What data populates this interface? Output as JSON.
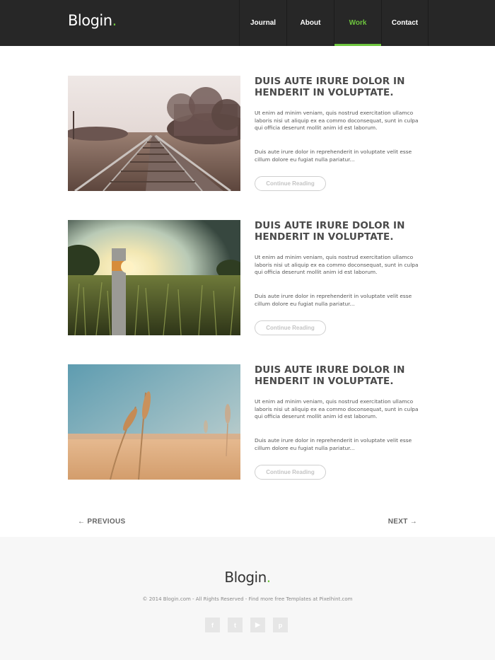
{
  "header": {
    "logo_text": "Blogin",
    "logo_dot": ".",
    "nav": [
      {
        "label": "Journal"
      },
      {
        "label": "About"
      },
      {
        "label": "Work",
        "active": true
      },
      {
        "label": "Contact"
      }
    ]
  },
  "posts": [
    {
      "title": "DUIS AUTE IRURE DOLOR IN HENDERIT IN VOLUPTATE.",
      "p1": "Ut enim ad minim veniam, quis nostrud exercitation ullamco laboris nisi ut aliquip ex ea commo doconsequat, sunt in culpa qui officia deserunt mollit anim id est laborum.",
      "p2": "Duis aute irure dolor in reprehenderit in voluptate velit esse cillum dolore eu fugiat nulla pariatur...",
      "button": "Continue Reading"
    },
    {
      "title": "DUIS AUTE IRURE DOLOR IN HENDERIT IN VOLUPTATE.",
      "p1": "Ut enim ad minim veniam, quis nostrud exercitation ullamco laboris nisi ut aliquip ex ea commo doconsequat, sunt in culpa qui officia deserunt mollit anim id est laborum.",
      "p2": "Duis aute irure dolor in reprehenderit in voluptate velit esse cillum dolore eu fugiat nulla pariatur...",
      "button": "Continue Reading"
    },
    {
      "title": "DUIS AUTE IRURE DOLOR IN HENDERIT IN VOLUPTATE.",
      "p1": "Ut enim ad minim veniam, quis nostrud exercitation ullamco laboris nisi ut aliquip ex ea commo doconsequat, sunt in culpa qui officia deserunt mollit anim id est laborum.",
      "p2": "Duis aute irure dolor in reprehenderit in voluptate velit esse cillum dolore eu fugiat nulla pariatur...",
      "button": "Continue Reading"
    }
  ],
  "pagination": {
    "previous": "← PREVIOUS",
    "next": "NEXT →"
  },
  "footer": {
    "logo_text": "Blogin",
    "logo_dot": ".",
    "copyright": "© 2014 Blogin.com - All Rights Reserved - Find more free Templates at Pixelhint.com",
    "social": [
      {
        "icon": "facebook-icon",
        "glyph": "f"
      },
      {
        "icon": "twitter-icon",
        "glyph": "t"
      },
      {
        "icon": "youtube-icon",
        "glyph": "▶"
      },
      {
        "icon": "pinterest-icon",
        "glyph": "p"
      }
    ]
  },
  "colors": {
    "accent": "#6ec53e",
    "header_bg": "#272727",
    "footer_bg": "#f7f7f7"
  }
}
